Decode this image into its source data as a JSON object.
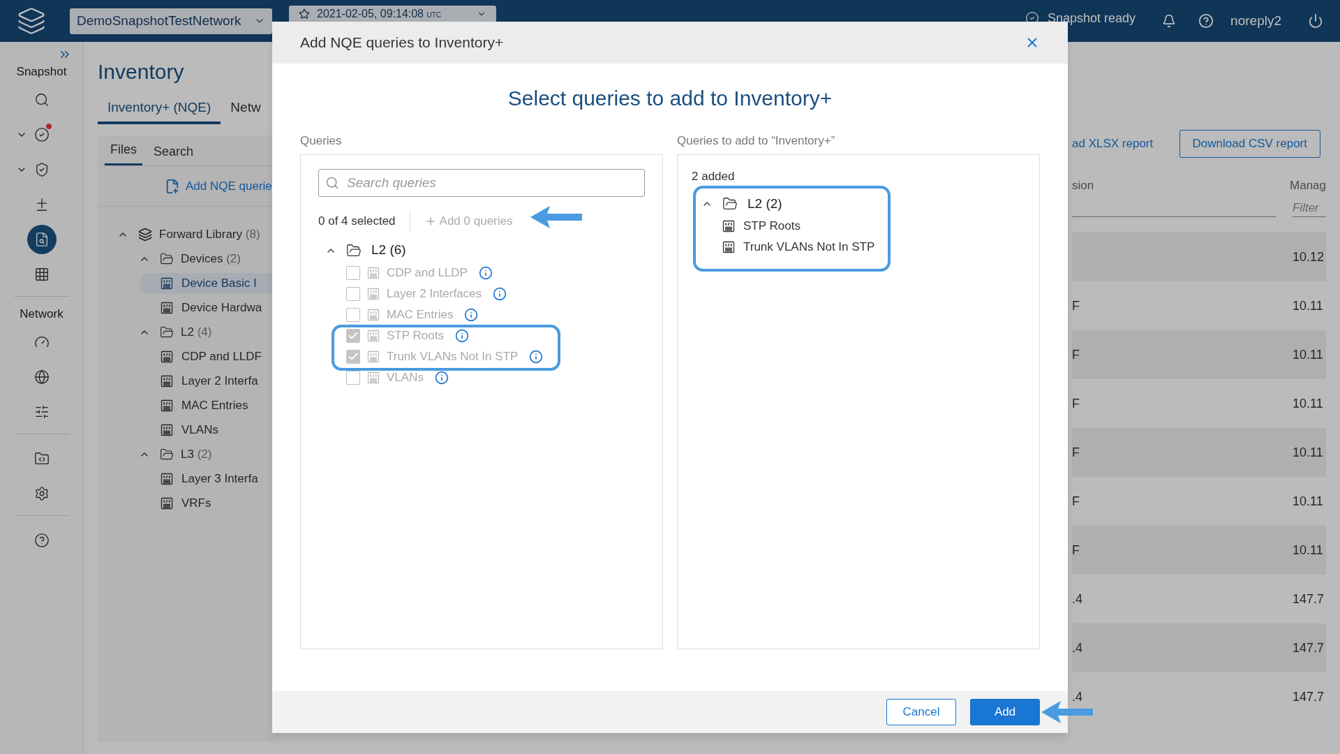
{
  "top_bar": {
    "network_selector": "DemoSnapshotTestNetwork",
    "snapshot_selector": "2021-02-05, 09:14:08",
    "snapshot_timezone": "UTC",
    "status": "Snapshot ready",
    "user": "noreply2"
  },
  "nav_rail": {
    "sections": [
      {
        "title": "Snapshot",
        "items": [
          {
            "selected": false,
            "alert": false,
            "expandable": false
          },
          {
            "selected": false,
            "alert": true,
            "expandable": true
          },
          {
            "selected": false,
            "alert": false,
            "expandable": true
          },
          {
            "selected": false,
            "alert": false,
            "expandable": false
          },
          {
            "selected": true,
            "alert": false,
            "expandable": false
          },
          {
            "selected": false,
            "alert": false,
            "expandable": false
          }
        ]
      },
      {
        "title": "Network",
        "items": [
          {
            "selected": false,
            "alert": false,
            "expandable": false
          },
          {
            "selected": false,
            "alert": false,
            "expandable": false
          },
          {
            "selected": false,
            "alert": false,
            "expandable": false
          }
        ]
      },
      {
        "items": [
          {
            "selected": false,
            "alert": false,
            "expandable": false
          },
          {
            "selected": false,
            "alert": false,
            "expandable": false
          }
        ]
      },
      {
        "items": [
          {
            "selected": false,
            "alert": false,
            "expandable": false
          }
        ]
      }
    ]
  },
  "page": {
    "title": "Inventory",
    "tabs": [
      {
        "label": "Inventory+ (NQE)",
        "selected": true
      },
      {
        "label": "Netw",
        "selected": false
      }
    ],
    "file_tabs": [
      {
        "label": "Files",
        "selected": true
      },
      {
        "label": "Search",
        "selected": false
      }
    ],
    "add_button": "Add NQE querie",
    "library": [
      {
        "label": "Forward Library",
        "count": "(8)",
        "kind": "library",
        "expanded": true,
        "children": [
          {
            "label": "Devices",
            "count": "(2)",
            "kind": "folder",
            "expanded": true,
            "children": [
              {
                "label": "Device Basic I",
                "kind": "query",
                "selected": true
              },
              {
                "label": "Device Hardwa",
                "kind": "query",
                "selected": false
              }
            ]
          },
          {
            "label": "L2",
            "count": "(4)",
            "kind": "folder",
            "expanded": true,
            "children": [
              {
                "label": "CDP and LLDF",
                "kind": "query",
                "selected": false
              },
              {
                "label": "Layer 2 Interfa",
                "kind": "query",
                "selected": false
              },
              {
                "label": "MAC Entries",
                "kind": "query",
                "selected": false
              },
              {
                "label": "VLANs",
                "kind": "query",
                "selected": false
              }
            ]
          },
          {
            "label": "L3",
            "count": "(2)",
            "kind": "folder",
            "expanded": true,
            "children": [
              {
                "label": "Layer 3 Interfa",
                "kind": "query",
                "selected": false
              },
              {
                "label": "VRFs",
                "kind": "query",
                "selected": false
              }
            ]
          }
        ]
      }
    ],
    "xlsx_button": "ad XLSX report",
    "csv_button": "Download CSV report",
    "table": {
      "columns": [
        {
          "label": "sion"
        },
        {
          "label": "Manag",
          "filter_placeholder": "Filter"
        }
      ],
      "rows": [
        {
          "cells": [
            "",
            "10.12"
          ]
        },
        {
          "cells": [
            "F",
            "10.11"
          ]
        },
        {
          "cells": [
            "F",
            "10.11"
          ]
        },
        {
          "cells": [
            "F",
            "10.11"
          ]
        },
        {
          "cells": [
            "F",
            "10.11"
          ]
        },
        {
          "cells": [
            "F",
            "10.11"
          ]
        },
        {
          "cells": [
            "F",
            "10.11"
          ]
        },
        {
          "cells": [
            ".4",
            "147.7"
          ]
        },
        {
          "cells": [
            ".4",
            "147.7"
          ]
        },
        {
          "cells": [
            ".4",
            "147.7"
          ]
        }
      ]
    }
  },
  "dialog": {
    "title": "Add NQE queries to Inventory+",
    "heading": "Select queries to add to Inventory+",
    "source": {
      "label": "Queries",
      "search_placeholder": "Search queries",
      "selection_count": "0 of 4 selected",
      "add_queries_button": {
        "label": "Add 0 queries",
        "disabled": true
      },
      "group": {
        "label": "L2",
        "count": "(6)",
        "expanded": true,
        "items": [
          {
            "label": "CDP and LLDP",
            "checked": false,
            "disabled": true
          },
          {
            "label": "Layer 2 Interfaces",
            "checked": false,
            "disabled": true
          },
          {
            "label": "MAC Entries",
            "checked": false,
            "disabled": true
          },
          {
            "label": "STP Roots",
            "checked": true,
            "disabled": true
          },
          {
            "label": "Trunk VLANs Not In STP",
            "checked": true,
            "disabled": true
          },
          {
            "label": "VLANs",
            "checked": false,
            "disabled": true
          }
        ]
      }
    },
    "target": {
      "label": "Queries to add to “Inventory+”",
      "added_count": "2 added",
      "group": {
        "label": "L2",
        "count": "(2)",
        "expanded": true,
        "items": [
          {
            "label": "STP Roots"
          },
          {
            "label": "Trunk VLANs Not In STP"
          }
        ]
      }
    },
    "buttons": [
      {
        "label": "Cancel",
        "kind": "secondary"
      },
      {
        "label": "Add",
        "kind": "primary"
      }
    ]
  }
}
